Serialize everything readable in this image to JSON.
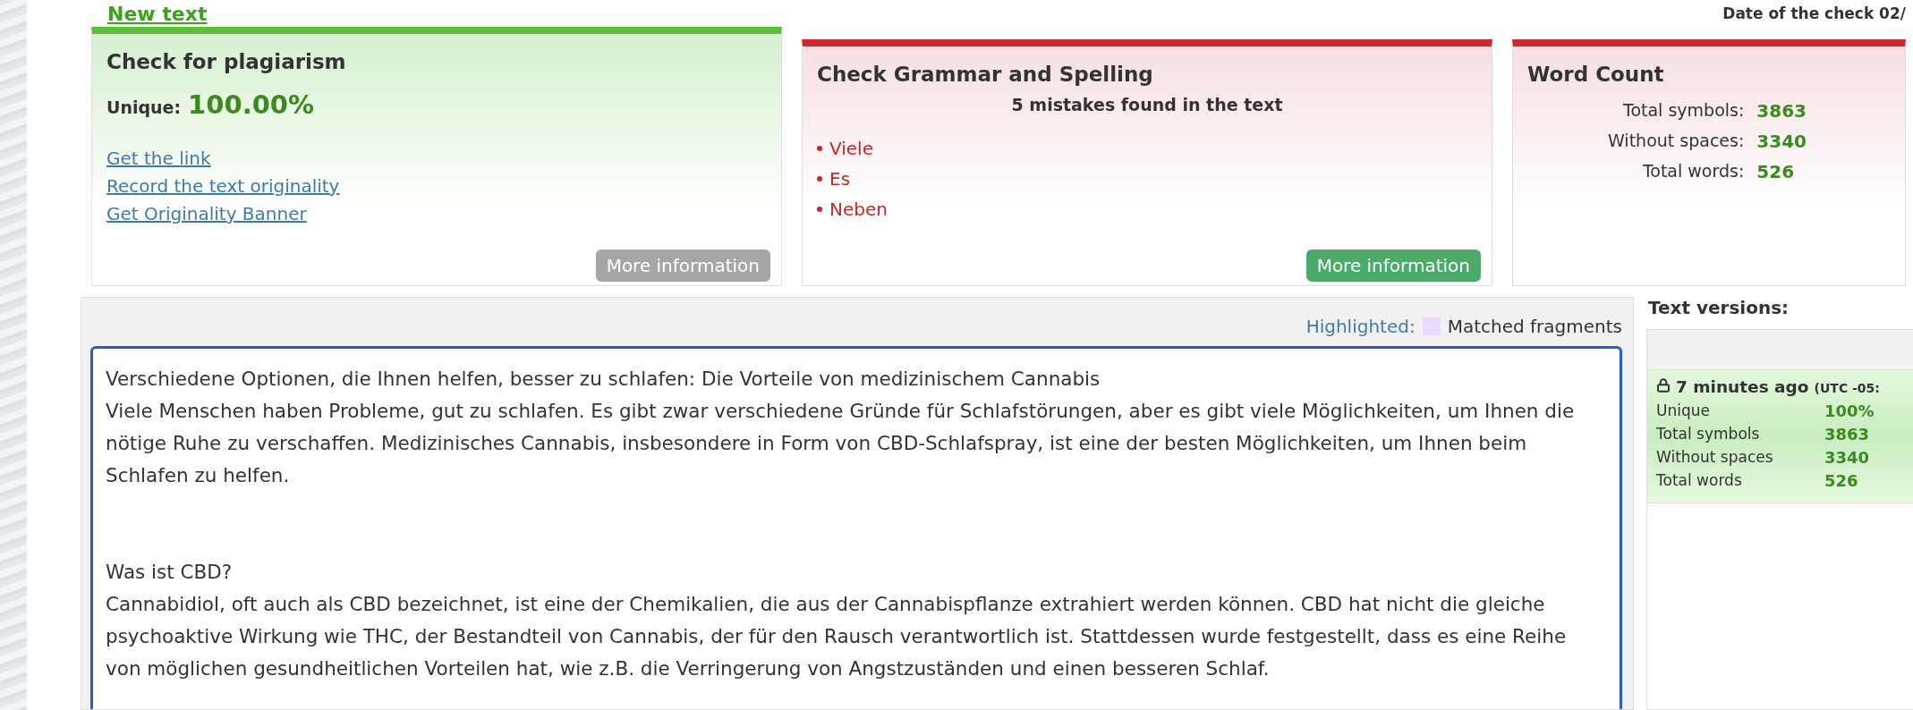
{
  "header": {
    "new_text_link": "New text",
    "check_date": "Date of the check 02/"
  },
  "cards": [
    {
      "kind": "plagiarism",
      "title": "Check for plagiarism",
      "unique_label": "Unique:",
      "unique_value": "100.00%",
      "links": [
        "Get the link",
        "Record the text originality",
        "Get Originality Banner"
      ],
      "button": {
        "label": "More information",
        "disabled": true
      }
    },
    {
      "kind": "grammar",
      "title": "Check Grammar and Spelling",
      "summary": "5 mistakes found in the text",
      "mistakes": [
        "Viele",
        "Es",
        "Neben"
      ],
      "button": {
        "label": "More information",
        "disabled": false
      }
    },
    {
      "kind": "word_count",
      "title": "Word Count",
      "stats": [
        {
          "label": "Total symbols:",
          "value": "3863"
        },
        {
          "label": "Without spaces:",
          "value": "3340"
        },
        {
          "label": "Total words:",
          "value": "526"
        }
      ]
    }
  ],
  "editor": {
    "legend_label": "Highlighted:",
    "legend_text": "Matched fragments",
    "blocks": [
      {
        "lines": [
          "Verschiedene Optionen, die Ihnen helfen, besser zu schlafen: Die Vorteile von medizinischem Cannabis",
          "Viele Menschen haben Probleme, gut zu schlafen. Es gibt zwar verschiedene Gründe für Schlafstörungen, aber es gibt viele Möglichkeiten, um Ihnen die nötige Ruhe zu verschaffen. Medizinisches Cannabis, insbesondere in Form von CBD-Schlafspray, ist eine der besten Möglichkeiten, um Ihnen beim Schlafen zu helfen."
        ]
      },
      {
        "lines": [
          "Was ist CBD?",
          "Cannabidiol, oft auch als CBD bezeichnet, ist eine der Chemikalien, die aus der Cannabispflanze extrahiert werden können. CBD hat nicht die gleiche psychoaktive Wirkung wie THC, der Bestandteil von Cannabis, der für den Rausch verantwortlich ist. Stattdessen wurde festgestellt, dass es eine Reihe von möglichen gesundheitlichen Vorteilen hat, wie z.B. die Verringerung von Angstzuständen und einen besseren Schlaf."
        ]
      }
    ]
  },
  "versions": {
    "title": "Text versions:",
    "entries": [
      {
        "time": "7 minutes ago",
        "zone": "(UTC -05:",
        "locked": true,
        "stats": [
          {
            "label": "Unique",
            "value": "100%"
          },
          {
            "label": "Total symbols",
            "value": "3863"
          },
          {
            "label": "Without spaces",
            "value": "3340"
          },
          {
            "label": "Total words",
            "value": "526"
          }
        ]
      }
    ]
  }
}
